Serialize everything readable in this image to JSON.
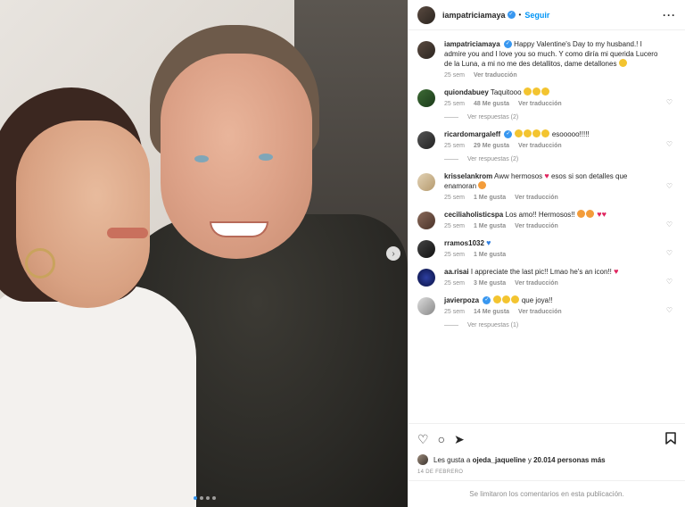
{
  "header": {
    "username": "iampatriciamaya",
    "separator": "•",
    "follow_label": "Seguir",
    "more_icon": "more-horizontal-icon"
  },
  "caption": {
    "username": "iampatriciamaya",
    "text": "Happy Valentine's Day to my husband.! I admire you and I love you so much. Y como diría mi querida Lucero de la Luna, a mi no me des detallitos, dame detallones",
    "time": "25 sem",
    "translate": "Ver traducción"
  },
  "comments": [
    {
      "username": "quiondabuey",
      "text": "Taquitooo",
      "emojis": 3,
      "time": "25 sem",
      "likes": "48 Me gusta",
      "translate": "Ver traducción",
      "replies": "Ver respuestas (2)"
    },
    {
      "username": "ricardomargaleff",
      "text": "esooooo!!!!!",
      "emojis": 4,
      "time": "25 sem",
      "likes": "29 Me gusta",
      "translate": "Ver traducción",
      "replies": "Ver respuestas (2)"
    },
    {
      "username": "krisselankrom",
      "text": "Aww hermosos",
      "text2": "esos si son detalles que enamoran",
      "time": "25 sem",
      "likes": "1 Me gusta",
      "translate": "Ver traducción"
    },
    {
      "username": "ceciliaholisticspa",
      "text": "Los amo!! Hermosos!!",
      "time": "25 sem",
      "likes": "1 Me gusta",
      "translate": "Ver traducción"
    },
    {
      "username": "rramos1032",
      "text": "",
      "time": "25 sem",
      "likes": "1 Me gusta"
    },
    {
      "username": "aa.risai",
      "text": "I appreciate the last pic!! Lmao he's an icon!!",
      "time": "25 sem",
      "likes": "3 Me gusta",
      "translate": "Ver traducción"
    },
    {
      "username": "javierpoza",
      "text": "que joya!!",
      "time": "25 sem",
      "likes": "14 Me gusta",
      "translate": "Ver traducción",
      "replies": "Ver respuestas (1)"
    }
  ],
  "actions": {
    "like_icon": "heart-icon",
    "comment_icon": "comment-icon",
    "share_icon": "send-icon",
    "save_icon": "bookmark-icon"
  },
  "likes_summary": {
    "prefix": "Les gusta a",
    "user": "ojeda_jaqueline",
    "middle": "y",
    "count": "20.014 personas más"
  },
  "date": "14 DE FEBRERO",
  "footer": "Se limitaron los comentarios en esta publicación.",
  "colors": {
    "accent": "#0095f6",
    "verified": "#3897f0",
    "muted": "#8e8e8e"
  }
}
